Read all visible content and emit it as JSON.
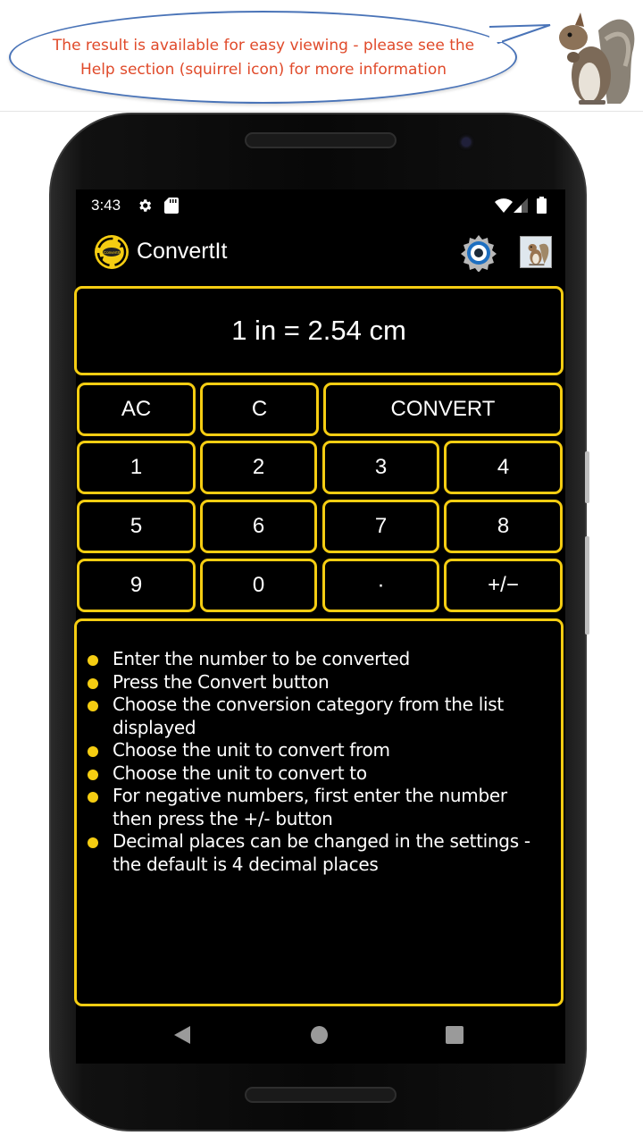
{
  "banner": {
    "message_line1": "The result is available for easy viewing - please see the",
    "message_line2": "Help section (squirrel icon) for more information",
    "text_color": "#e04a2a",
    "bubble_border_color": "#4a74b8",
    "image": "squirrel-image"
  },
  "status_bar": {
    "time": "3:43",
    "left_icons": [
      "settings-gear-icon",
      "sd-card-icon"
    ],
    "right_icons": [
      "wifi-icon",
      "signal-icon",
      "battery-icon"
    ]
  },
  "app_bar": {
    "logo": "convertit-logo-icon",
    "logo_text": "ConvertIt",
    "title": "ConvertIt",
    "actions": [
      {
        "name": "settings",
        "icon": "gear-icon"
      },
      {
        "name": "help",
        "icon": "squirrel-icon"
      }
    ]
  },
  "display": {
    "value": "1 in = 2.54 cm"
  },
  "keypad": {
    "row0": [
      {
        "label": "AC",
        "name": "all-clear-button"
      },
      {
        "label": "C",
        "name": "clear-button"
      },
      {
        "label": "CONVERT",
        "name": "convert-button"
      }
    ],
    "row1": [
      {
        "label": "1"
      },
      {
        "label": "2"
      },
      {
        "label": "3"
      },
      {
        "label": "4"
      }
    ],
    "row2": [
      {
        "label": "5"
      },
      {
        "label": "6"
      },
      {
        "label": "7"
      },
      {
        "label": "8"
      }
    ],
    "row3": [
      {
        "label": "9"
      },
      {
        "label": "0"
      },
      {
        "label": "·"
      },
      {
        "label": "+/−"
      }
    ]
  },
  "help": {
    "items": [
      "Enter the number to be converted",
      "Press the Convert button",
      "Choose the conversion category from the list displayed",
      "Choose the unit to convert from",
      "Choose the unit to convert to",
      "For negative numbers, first enter the number then press the +/- button",
      "Decimal places can be changed in the settings - the default is 4 decimal places"
    ]
  },
  "nav_bar": {
    "buttons": [
      "back",
      "home",
      "recents"
    ]
  },
  "colors": {
    "accent": "#f5cd12",
    "background": "#000000",
    "text": "#ffffff",
    "nav_icons": "#9a9a9a"
  }
}
